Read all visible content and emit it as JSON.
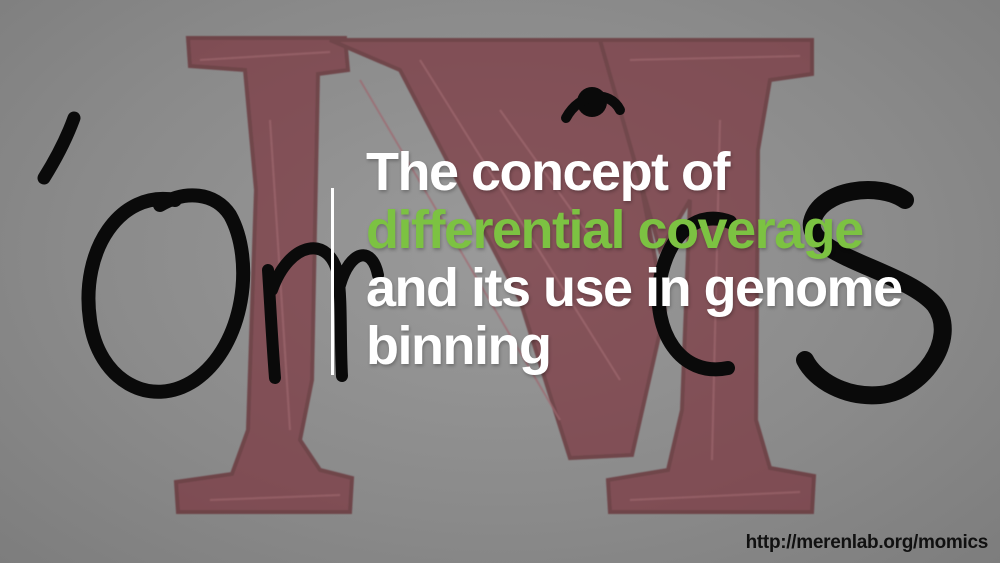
{
  "slide": {
    "logo_text": "'OMICS",
    "title_lines": [
      "The concept of",
      "differential coverage",
      "and its use in genome",
      "binning"
    ],
    "url": "http://merenlab.org/momics"
  },
  "colors": {
    "background": "#8c8c8c",
    "title": "#ffffff",
    "accent": "#7cc242",
    "logo_m": "#7a2a34",
    "logo_letters": "#0a0a0a",
    "url": "#111111"
  },
  "icons": {
    "logo": "hand-drawn-omics-logo-icon"
  }
}
